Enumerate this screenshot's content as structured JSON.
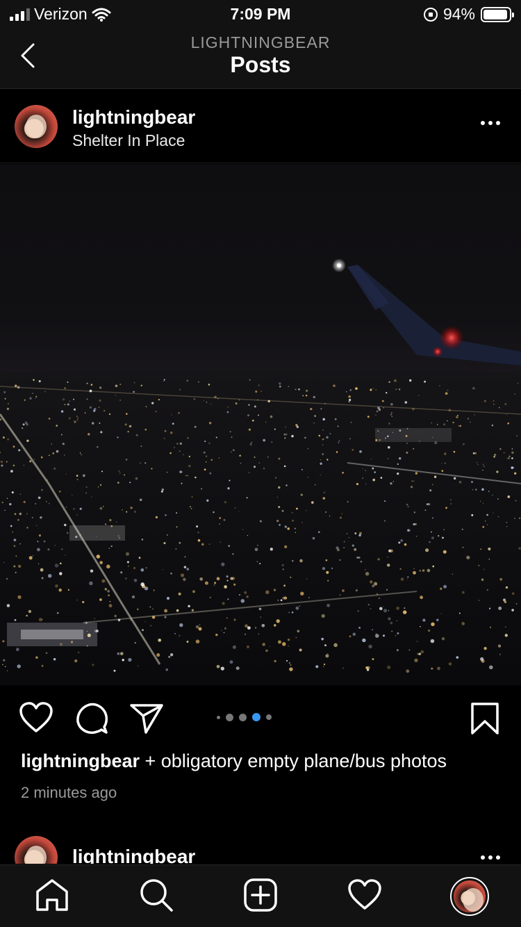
{
  "status_bar": {
    "carrier": "Verizon",
    "time": "7:09 PM",
    "battery_text": "94%",
    "battery_level": 0.94,
    "icons": [
      "signal-icon",
      "wifi-icon",
      "orientation-lock-icon",
      "battery-icon"
    ]
  },
  "nav": {
    "subtitle": "LIGHTNINGBEAR",
    "title": "Posts",
    "back_icon": "chevron-left-icon"
  },
  "post": {
    "username": "lightningbear",
    "location": "Shelter In Place",
    "more_icon": "more-horizontal-icon",
    "image_description_icon": "night-city-photo",
    "carousel": {
      "count": 5,
      "active_index": 3
    },
    "actions": [
      "heart-icon",
      "comment-icon",
      "share-icon",
      "bookmark-icon"
    ],
    "caption_user": "lightningbear",
    "caption_text": " + obligatory empty plane/bus photos",
    "time_ago": "2 minutes ago"
  },
  "next_post": {
    "username": "lightningbear"
  },
  "tab_bar": {
    "items": [
      "home-icon",
      "search-icon",
      "new-post-icon",
      "activity-icon",
      "profile-avatar"
    ]
  },
  "colors": {
    "background": "#000000",
    "header": "#121212",
    "accent": "#3897f0",
    "muted_text": "#9a9a9a"
  }
}
